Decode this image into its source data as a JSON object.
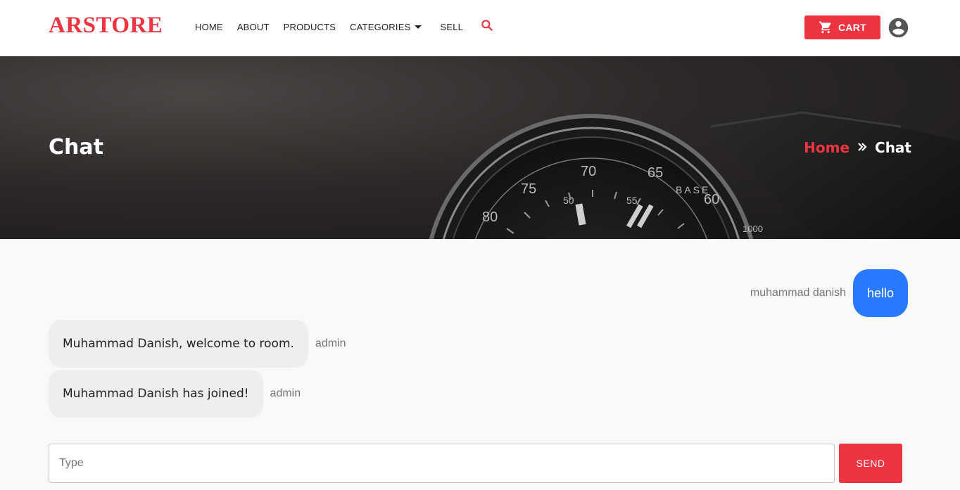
{
  "brand": {
    "name": "ARSTORE",
    "color": "#ee3440"
  },
  "nav": {
    "items": [
      {
        "label": "HOME"
      },
      {
        "label": "ABOUT"
      },
      {
        "label": "PRODUCTS"
      },
      {
        "label": "CATEGORIES",
        "dropdown": true
      },
      {
        "label": "SELL"
      }
    ],
    "search_icon": "search-icon",
    "cart_label": "CART",
    "cart_icon": "cart-icon",
    "account_icon": "account-circle-icon"
  },
  "banner": {
    "title": "Chat",
    "breadcrumb": {
      "home": "Home",
      "separator_icon": "double-chevron-right-icon",
      "current": "Chat"
    }
  },
  "chat": {
    "messages": [
      {
        "side": "right",
        "sender": "muhammad danish",
        "text": "hello"
      },
      {
        "side": "left",
        "sender": "admin",
        "text": "Muhammad Danish, welcome to room."
      },
      {
        "side": "left",
        "sender": "admin",
        "text": "Muhammad Danish has joined!"
      }
    ],
    "input_placeholder": "Type",
    "send_label": "SEND"
  },
  "colors": {
    "accent": "#ee3440",
    "own_bubble": "#2979ff",
    "other_bubble": "#eeeeee"
  }
}
